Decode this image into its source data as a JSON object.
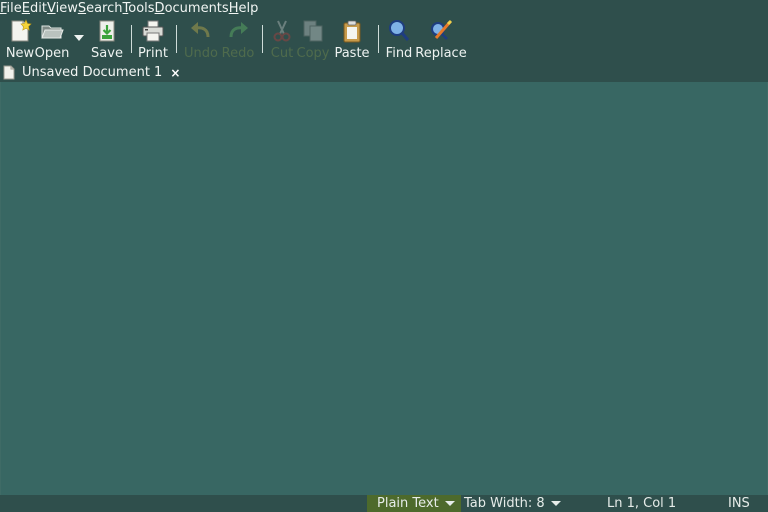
{
  "menu": [
    {
      "acc": "F",
      "rest": "ile"
    },
    {
      "acc": "E",
      "rest": "dit"
    },
    {
      "acc": "V",
      "rest": "iew"
    },
    {
      "acc": "S",
      "rest": "earch"
    },
    {
      "acc": "T",
      "rest": "ools"
    },
    {
      "acc": "D",
      "rest": "ocuments"
    },
    {
      "acc": "H",
      "rest": "elp"
    }
  ],
  "toolbar": {
    "new": "New",
    "open": "Open",
    "save": "Save",
    "print": "Print",
    "undo": "Undo",
    "redo": "Redo",
    "cut": "Cut",
    "copy": "Copy",
    "paste": "Paste",
    "find": "Find",
    "replace": "Replace"
  },
  "tab": {
    "title": "Unsaved Document 1",
    "close": "×"
  },
  "status": {
    "language": "Plain Text",
    "tab_width": "Tab Width:  8",
    "position": "Ln 1, Col 1",
    "mode": "INS"
  },
  "colors": {
    "background": "#2e4f4c",
    "editor": "#386763",
    "language_badge": "#4d6a2c"
  },
  "icons": {
    "new": "new-document-icon",
    "open": "open-folder-icon",
    "save": "save-icon",
    "print": "printer-icon",
    "undo": "undo-icon",
    "redo": "redo-icon",
    "cut": "scissors-icon",
    "copy": "copy-icon",
    "paste": "clipboard-icon",
    "find": "magnifier-icon",
    "replace": "find-replace-icon"
  }
}
